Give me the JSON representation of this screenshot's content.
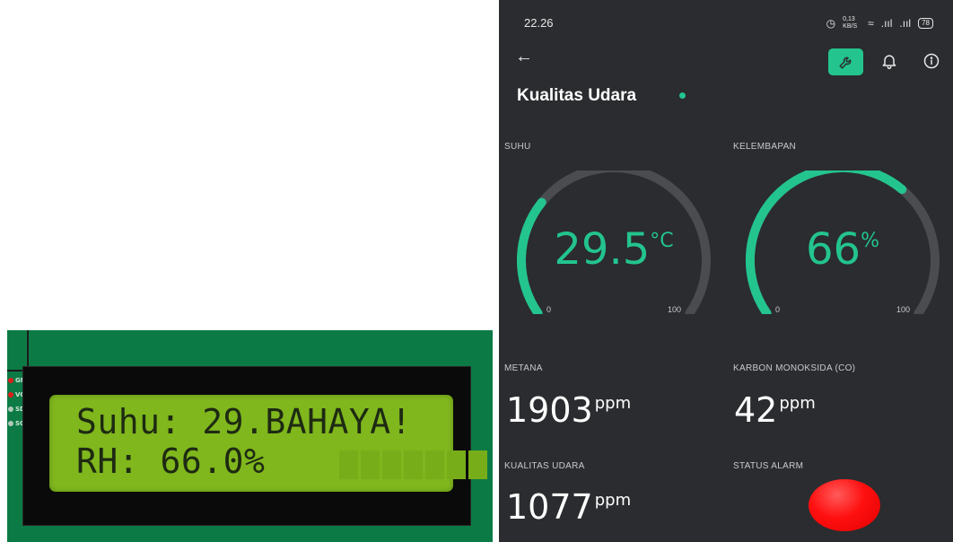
{
  "lcd": {
    "pins": [
      "GND",
      "VCC",
      "SDA",
      "SCL"
    ],
    "line1": "Suhu: 29.BAHAYA!",
    "line2": "RH: 66.0%"
  },
  "phone": {
    "status_bar": {
      "time": "22.26",
      "network_speed": "0,13 KB/S",
      "battery": "78"
    },
    "toolbar": {
      "back_icon": "back-arrow-icon",
      "wrench_icon": "wrench-icon",
      "bell_icon": "bell-icon",
      "info_icon": "info-icon"
    },
    "title": "Kualitas Udara",
    "online_color": "#23c48e",
    "accent_color": "#23c48e",
    "gauges": [
      {
        "label": "SUHU",
        "value": "29.5",
        "unit": "°C",
        "min": "0",
        "max": "100",
        "fraction": 0.295
      },
      {
        "label": "KELEMBAPAN",
        "value": "66",
        "unit": "%",
        "min": "0",
        "max": "100",
        "fraction": 0.66
      }
    ],
    "metana": {
      "label": "METANA",
      "value": "1903",
      "unit": "ppm"
    },
    "co": {
      "label": "KARBON MONOKSIDA (CO)",
      "value": "42",
      "unit": "ppm"
    },
    "kualitas": {
      "label": "KUALITAS UDARA",
      "value": "1077",
      "unit": "ppm"
    },
    "alarm": {
      "label": "STATUS ALARM",
      "color": "#ff1010"
    }
  }
}
